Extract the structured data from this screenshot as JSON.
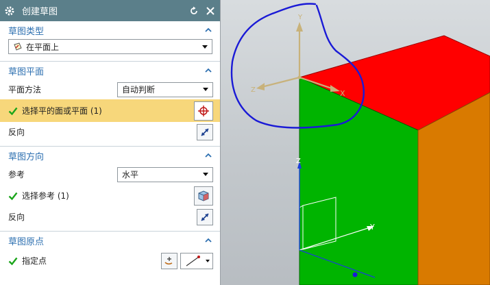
{
  "dialog": {
    "title": "创建草图"
  },
  "sketch_type": {
    "header": "草图类型",
    "value": "在平面上"
  },
  "sketch_plane": {
    "header": "草图平面",
    "method_label": "平面方法",
    "method_value": "自动判断",
    "select_label": "选择平的面或平面 (1)",
    "reverse_label": "反向"
  },
  "sketch_direction": {
    "header": "草图方向",
    "reference_label": "参考",
    "reference_value": "水平",
    "select_label": "选择参考 (1)",
    "reverse_label": "反向"
  },
  "sketch_origin": {
    "header": "草图原点",
    "point_label": "指定点"
  },
  "viewport": {
    "axis_labels": {
      "y_top": "Y",
      "x_top": "X",
      "z_top": "Z",
      "z_face": "Z",
      "y_face": "Y"
    },
    "colors": {
      "top_face": "#ff0000",
      "front_face": "#00b400",
      "side_face": "#d97a00",
      "annotation": "#1a1ad6"
    }
  }
}
